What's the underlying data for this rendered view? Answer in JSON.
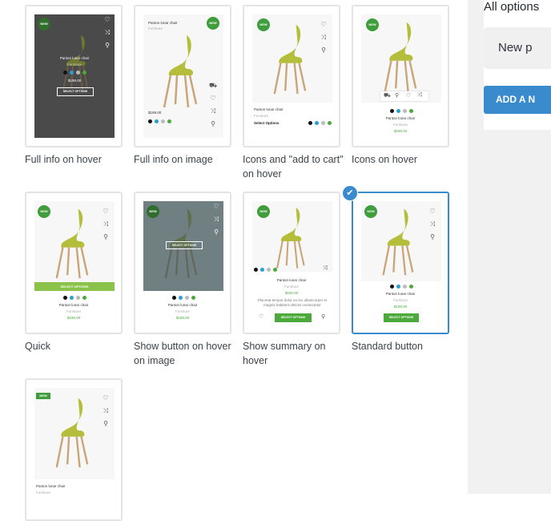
{
  "options": [
    {
      "id": "full-info-hover",
      "label": "Full info on hover",
      "selected": false
    },
    {
      "id": "full-info-image",
      "label": "Full info on image",
      "selected": false
    },
    {
      "id": "icons-add-to-cart",
      "label": "Icons and \"add to cart\" on hover",
      "selected": false
    },
    {
      "id": "icons-hover",
      "label": "Icons on hover",
      "selected": false
    },
    {
      "id": "quick",
      "label": "Quick",
      "selected": false
    },
    {
      "id": "show-button-hover-image",
      "label": "Show button on hover on image",
      "selected": false
    },
    {
      "id": "show-summary-hover",
      "label": "Show summary on hover",
      "selected": false
    },
    {
      "id": "standard-button",
      "label": "Standard button",
      "selected": true
    },
    {
      "id": "tiled",
      "label": "",
      "selected": false
    }
  ],
  "product": {
    "title": "Panton lunar chair",
    "category": "Furniture",
    "price": "$199.00",
    "badge": "NEW",
    "select_options": "SELECT OPTIONS",
    "select_options_mixed": "Select Options",
    "summary": "Placerat tempor dolor eu leo ullamcorper et magnis habitant ultrices consectetur"
  },
  "swatch_colors": [
    "#111111",
    "#2a9fd6",
    "#bbbbbb",
    "#4caa3d"
  ],
  "sidebar": {
    "title": "All options",
    "select_value": "New p",
    "add_button": "ADD A N"
  }
}
